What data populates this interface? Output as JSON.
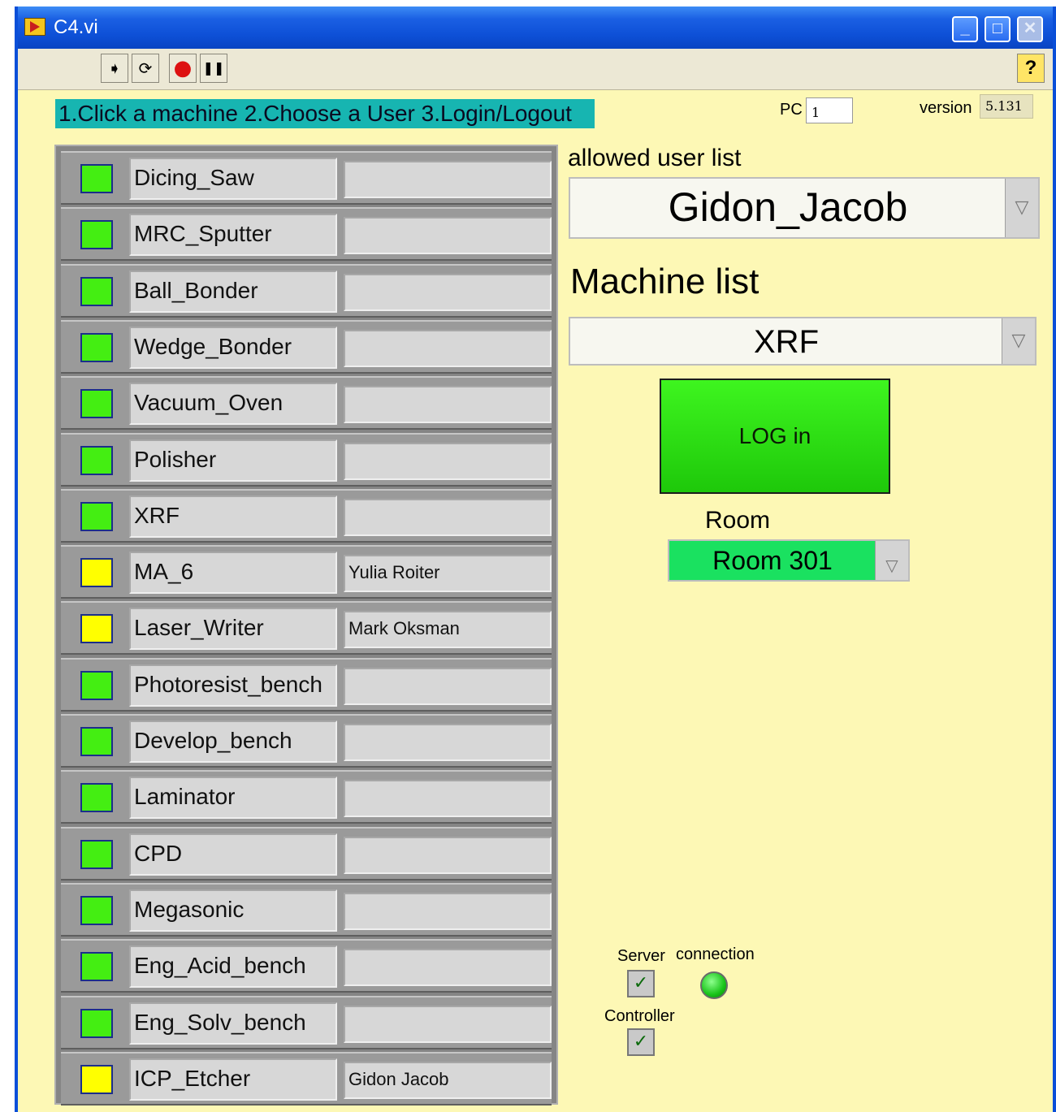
{
  "window": {
    "title": "C4.vi",
    "controls": {
      "minimize": "_",
      "maximize": "□",
      "close": "✕"
    }
  },
  "toolbar": {
    "tools": [
      {
        "name": "run-arrow-icon",
        "glyph": "➧"
      },
      {
        "name": "run-continuously-icon",
        "glyph": "⟳"
      },
      {
        "name": "abort-execution-icon",
        "glyph": "●"
      },
      {
        "name": "pause-icon",
        "glyph": "❚❚"
      }
    ],
    "help": "?"
  },
  "instructions": "1.Click a machine 2.Choose a User 3.Login/Logout",
  "pc": {
    "label": "PC",
    "value": "1"
  },
  "version": {
    "label": "version",
    "value": "5.131"
  },
  "machines": [
    {
      "name": "Dicing_Saw",
      "user": "",
      "status": "available",
      "color": "#44ee12"
    },
    {
      "name": "MRC_Sputter",
      "user": "",
      "status": "available",
      "color": "#44ee12"
    },
    {
      "name": "Ball_Bonder",
      "user": "",
      "status": "available",
      "color": "#44ee12"
    },
    {
      "name": "Wedge_Bonder",
      "user": "",
      "status": "available",
      "color": "#44ee12"
    },
    {
      "name": "Vacuum_Oven",
      "user": "",
      "status": "available",
      "color": "#44ee12"
    },
    {
      "name": "Polisher",
      "user": "",
      "status": "available",
      "color": "#44ee12"
    },
    {
      "name": "XRF",
      "user": "",
      "status": "available",
      "color": "#44ee12"
    },
    {
      "name": "MA_6",
      "user": "Yulia Roiter",
      "status": "in-use",
      "color": "#ffff00"
    },
    {
      "name": "Laser_Writer",
      "user": "Mark Oksman",
      "status": "in-use",
      "color": "#ffff00"
    },
    {
      "name": "Photoresist_bench",
      "user": "",
      "status": "available",
      "color": "#44ee12"
    },
    {
      "name": "Develop_bench",
      "user": "",
      "status": "available",
      "color": "#44ee12"
    },
    {
      "name": "Laminator",
      "user": "",
      "status": "available",
      "color": "#44ee12"
    },
    {
      "name": "CPD",
      "user": "",
      "status": "available",
      "color": "#44ee12"
    },
    {
      "name": "Megasonic",
      "user": "",
      "status": "available",
      "color": "#44ee12"
    },
    {
      "name": "Eng_Acid_bench",
      "user": "",
      "status": "available",
      "color": "#44ee12"
    },
    {
      "name": "Eng_Solv_bench",
      "user": "",
      "status": "available",
      "color": "#44ee12"
    },
    {
      "name": "ICP_Etcher",
      "user": "Gidon Jacob",
      "status": "in-use",
      "color": "#ffff00"
    }
  ],
  "allowed_users": {
    "label": "allowed user list",
    "selected": "Gidon_Jacob"
  },
  "machine_list": {
    "label": "Machine list",
    "selected": "XRF"
  },
  "login_button": "LOG in",
  "room": {
    "label": "Room",
    "selected": "Room 301"
  },
  "status": {
    "server_label": "Server",
    "connection_label": "connection",
    "controller_label": "Controller",
    "server_checked": true,
    "controller_checked": true,
    "connection_ok": true,
    "check_glyph": "✓"
  },
  "colors": {
    "panel_bg": "#fdf8b5",
    "instructions_bg": "#17b5b1",
    "login_green": "#33e617",
    "room_green": "#1ae160"
  }
}
